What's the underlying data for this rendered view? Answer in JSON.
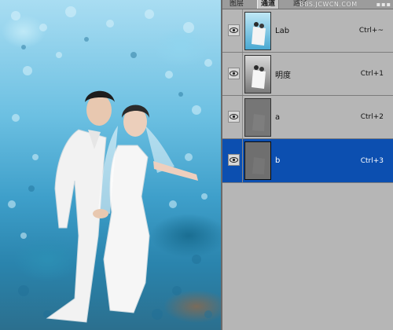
{
  "panel": {
    "tabs": [
      {
        "label": "图层"
      },
      {
        "label": "通道",
        "active": true
      },
      {
        "label": "路径"
      }
    ],
    "watermark": "BBS.JCWCN.COM",
    "channels": [
      {
        "name": "Lab",
        "shortcut": "Ctrl+~",
        "visible": true,
        "selected": false,
        "thumbnail": "color-composite"
      },
      {
        "name": "明度",
        "shortcut": "Ctrl+1",
        "visible": true,
        "selected": false,
        "thumbnail": "lightness-grayscale"
      },
      {
        "name": "a",
        "shortcut": "Ctrl+2",
        "visible": true,
        "selected": false,
        "thumbnail": "flat-gray"
      },
      {
        "name": "b",
        "shortcut": "Ctrl+3",
        "visible": true,
        "selected": true,
        "thumbnail": "flat-gray"
      }
    ],
    "icons": {
      "visibility": "eye-icon"
    },
    "colors": {
      "selection": "#0c4fb0",
      "panel_bg": "#b6b6b6"
    }
  },
  "canvas": {
    "subject": "wedding couple in blue-tinted flower field",
    "colors": {
      "field": "#5fb7dd",
      "dress": "#f4f4f4"
    }
  }
}
